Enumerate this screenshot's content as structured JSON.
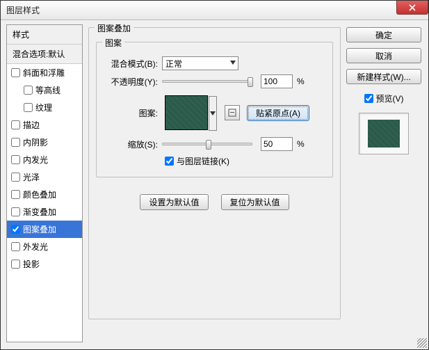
{
  "window": {
    "title": "图层样式"
  },
  "left": {
    "header": "样式",
    "subheader": "混合选项:默认",
    "items": [
      {
        "label": "斜面和浮雕",
        "checked": false,
        "active": false,
        "indent": false
      },
      {
        "label": "等高线",
        "checked": false,
        "active": false,
        "indent": true
      },
      {
        "label": "纹理",
        "checked": false,
        "active": false,
        "indent": true
      },
      {
        "label": "描边",
        "checked": false,
        "active": false,
        "indent": false
      },
      {
        "label": "内阴影",
        "checked": false,
        "active": false,
        "indent": false
      },
      {
        "label": "内发光",
        "checked": false,
        "active": false,
        "indent": false
      },
      {
        "label": "光泽",
        "checked": false,
        "active": false,
        "indent": false
      },
      {
        "label": "颜色叠加",
        "checked": false,
        "active": false,
        "indent": false
      },
      {
        "label": "渐变叠加",
        "checked": false,
        "active": false,
        "indent": false
      },
      {
        "label": "图案叠加",
        "checked": true,
        "active": true,
        "indent": false
      },
      {
        "label": "外发光",
        "checked": false,
        "active": false,
        "indent": false
      },
      {
        "label": "投影",
        "checked": false,
        "active": false,
        "indent": false
      }
    ]
  },
  "mid": {
    "group_title": "图案叠加",
    "inner_title": "图案",
    "blend_label": "混合模式(B):",
    "blend_value": "正常",
    "opacity_label": "不透明度(Y):",
    "opacity_value": "100",
    "percent": "%",
    "pattern_label": "图案:",
    "snap_label": "贴紧原点(A)",
    "scale_label": "缩放(S):",
    "scale_value": "50",
    "link_label": "与图层链接(K)",
    "set_default": "设置为默认值",
    "reset_default": "复位为默认值"
  },
  "right": {
    "ok": "确定",
    "cancel": "取消",
    "new_style": "新建样式(W)...",
    "preview": "预览(V)"
  }
}
